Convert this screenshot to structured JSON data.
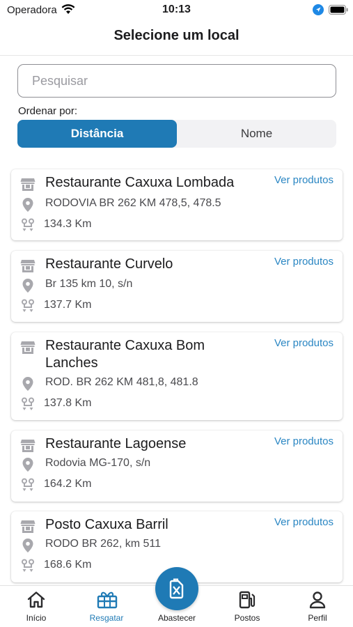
{
  "status_bar": {
    "carrier": "Operadora",
    "time": "10:13"
  },
  "header": {
    "title": "Selecione um local"
  },
  "search": {
    "placeholder": "Pesquisar",
    "value": ""
  },
  "sort": {
    "label": "Ordenar por:",
    "options": [
      "Distância",
      "Nome"
    ],
    "selected": "Distância"
  },
  "places": [
    {
      "name": "Restaurante Caxuxa Lombada",
      "address": "RODOVIA BR 262 KM 478,5, 478.5",
      "distance": "134.3 Km",
      "action": "Ver produtos"
    },
    {
      "name": "Restaurante Curvelo",
      "address": "Br 135 km 10, s/n",
      "distance": "137.7 Km",
      "action": "Ver produtos"
    },
    {
      "name": "Restaurante Caxuxa Bom Lanches",
      "address": "ROD. BR 262 KM 481,8, 481.8",
      "distance": "137.8 Km",
      "action": "Ver produtos"
    },
    {
      "name": "Restaurante Lagoense",
      "address": "Rodovia MG-170, s/n",
      "distance": "164.2 Km",
      "action": "Ver produtos"
    },
    {
      "name": "Posto Caxuxa Barril",
      "address": "RODO BR 262, km 511",
      "distance": "168.6 Km",
      "action": "Ver produtos"
    }
  ],
  "tabbar": {
    "items": [
      {
        "label": "Início",
        "icon": "home-icon"
      },
      {
        "label": "Resgatar",
        "icon": "gift-icon",
        "active": true
      },
      {
        "label": "Abastecer",
        "icon": "fuel-can-icon"
      },
      {
        "label": "Postos",
        "icon": "fuel-pump-icon"
      },
      {
        "label": "Perfil",
        "icon": "person-icon"
      }
    ]
  },
  "colors": {
    "accent": "#1f7ab5",
    "link": "#2a86c3",
    "icon_gray": "#a8a8ad"
  }
}
